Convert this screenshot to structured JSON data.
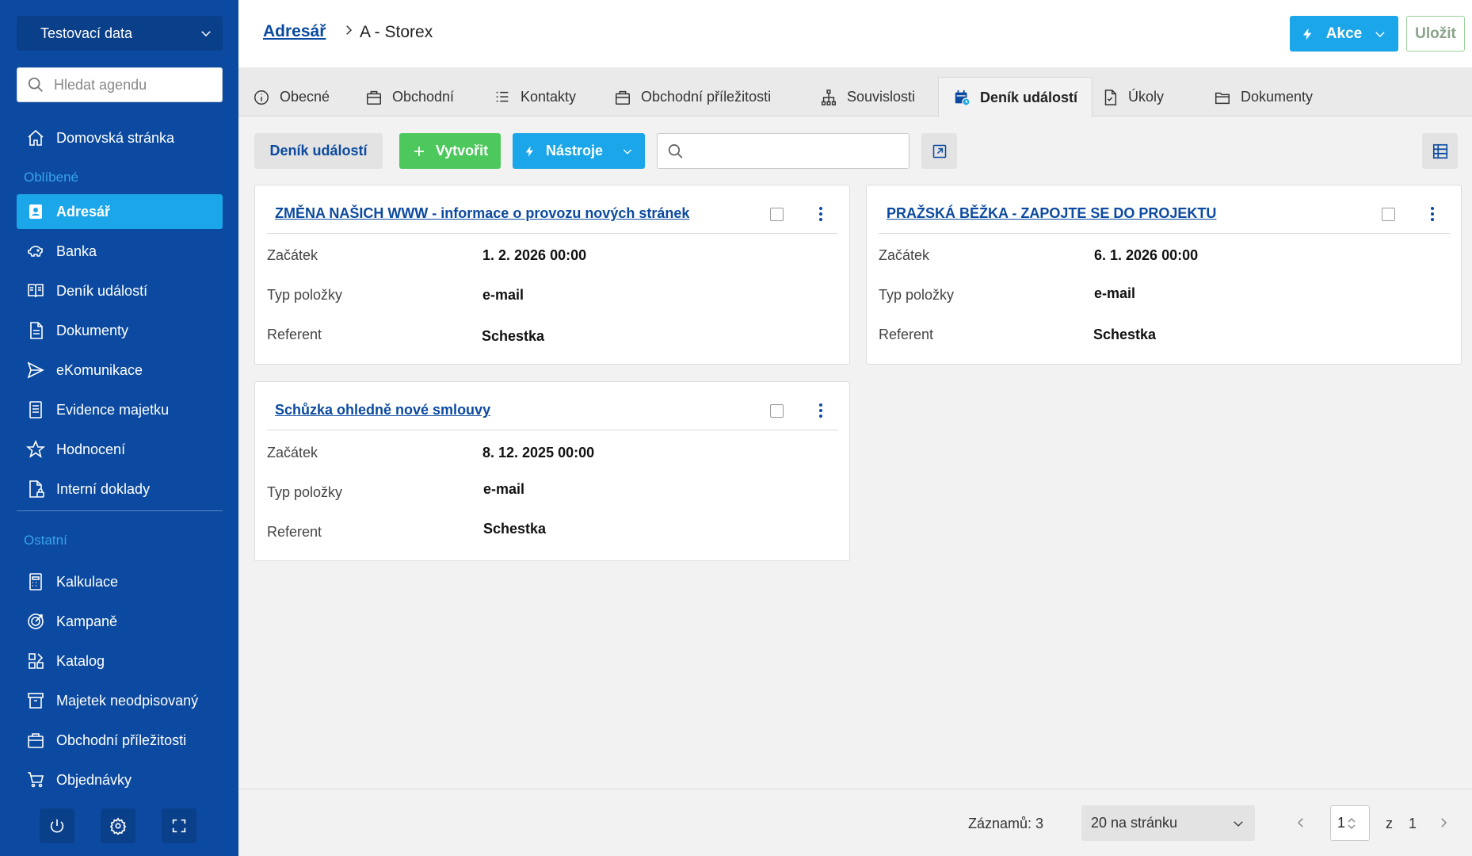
{
  "sidebar": {
    "company": "Testovací data",
    "search_placeholder": "Hledat agendu",
    "home": "Domovská stránka",
    "favorites_label": "Oblíbené",
    "favorites": [
      {
        "label": "Adresář",
        "icon": "contact-book-icon",
        "active": true
      },
      {
        "label": "Banka",
        "icon": "piggy-bank-icon"
      },
      {
        "label": "Deník událostí",
        "icon": "book-icon"
      },
      {
        "label": "Dokumenty",
        "icon": "document-icon"
      },
      {
        "label": "eKomunikace",
        "icon": "send-icon"
      },
      {
        "label": "Evidence majetku",
        "icon": "ledger-icon"
      },
      {
        "label": "Hodnocení",
        "icon": "star-icon"
      },
      {
        "label": "Interní doklady",
        "icon": "document-lock-icon"
      }
    ],
    "other_label": "Ostatní",
    "others": [
      {
        "label": "Kalkulace",
        "icon": "calculator-icon"
      },
      {
        "label": "Kampaně",
        "icon": "target-icon"
      },
      {
        "label": "Katalog",
        "icon": "catalog-icon"
      },
      {
        "label": "Majetek neodpisovaný",
        "icon": "archive-icon"
      },
      {
        "label": "Obchodní příležitosti",
        "icon": "briefcase-icon"
      },
      {
        "label": "Objednávky",
        "icon": "cart-icon"
      }
    ]
  },
  "header": {
    "breadcrumb_link": "Adresář",
    "breadcrumb_current": "A - Storex",
    "akce_label": "Akce",
    "save_label": "Uložit"
  },
  "tabs": [
    {
      "label": "Obecné",
      "icon": "info-icon"
    },
    {
      "label": "Obchodní",
      "icon": "briefcase-icon"
    },
    {
      "label": "Kontakty",
      "icon": "list-icon"
    },
    {
      "label": "Obchodní příležitosti",
      "icon": "briefcase-icon"
    },
    {
      "label": "Souvislosti",
      "icon": "hierarchy-icon"
    },
    {
      "label": "Deník událostí",
      "icon": "calendar-icon",
      "active": true
    },
    {
      "label": "Úkoly",
      "icon": "task-icon"
    },
    {
      "label": "Dokumenty",
      "icon": "folder-icon"
    }
  ],
  "toolbar": {
    "title": "Deník událostí",
    "create_label": "Vytvořit",
    "tools_label": "Nástroje",
    "search_value": ""
  },
  "field_labels": {
    "start": "Začátek",
    "type": "Typ položky",
    "referent": "Referent"
  },
  "cards": [
    {
      "title": "ZMĚNA NAŠICH WWW - informace o provozu nových stránek",
      "start": "1. 2. 2026  00:00",
      "type": "e-mail",
      "referent": "Schestka"
    },
    {
      "title": "PRAŽSKÁ BĚŽKA - ZAPOJTE SE DO PROJEKTU",
      "start": "6. 1. 2026  00:00",
      "type": "e-mail",
      "referent": "Schestka"
    },
    {
      "title": "Schůzka ohledně nové smlouvy",
      "start": "8. 12. 2025  00:00",
      "type": "e-mail",
      "referent": "Schestka"
    }
  ],
  "footer": {
    "records": "Záznamů: 3",
    "page_size": "20 na stránku",
    "page": "1",
    "of": "z",
    "total_pages": "1"
  },
  "colors": {
    "sidebar": "#0b4aa0",
    "accent": "#1aa6e8",
    "create": "#4cc85c"
  }
}
